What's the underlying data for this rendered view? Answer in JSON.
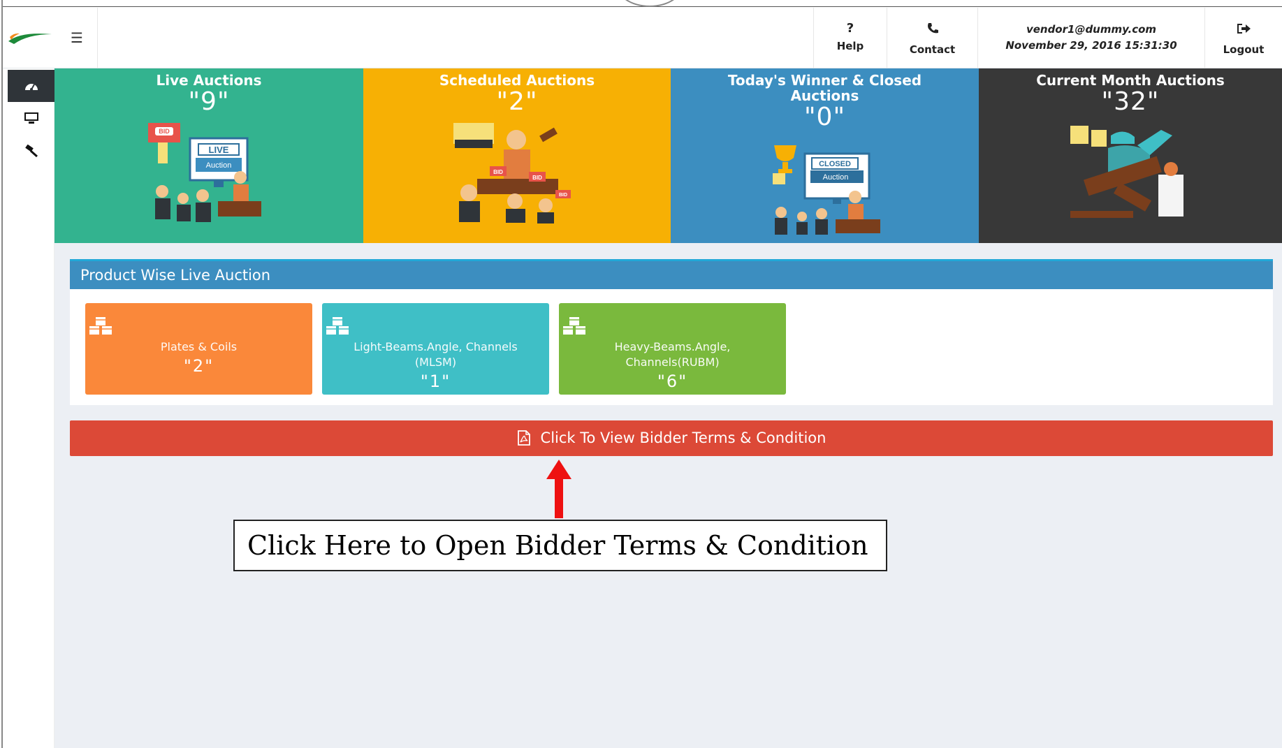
{
  "header": {
    "help_label": "Help",
    "help_icon": "question-icon",
    "contact_label": "Contact",
    "contact_icon": "phone-icon",
    "user_email": "vendor1@dummy.com",
    "datetime": "November 29, 2016 15:31:30",
    "logout_label": "Logout",
    "logout_icon": "sign-out-icon"
  },
  "sidebar": {
    "items": [
      {
        "icon": "dashboard-icon",
        "active": true
      },
      {
        "icon": "desktop-icon",
        "active": false
      },
      {
        "icon": "gavel-icon",
        "active": false
      }
    ]
  },
  "tiles": [
    {
      "title": "Live Auctions",
      "count": "\"9\"",
      "color": "#33b38f"
    },
    {
      "title": "Scheduled Auctions",
      "count": "\"2\"",
      "color": "#f7b004"
    },
    {
      "title": "Today's Winner & Closed Auctions",
      "count": "\"0\"",
      "color": "#3c8ec0"
    },
    {
      "title": "Current Month Auctions",
      "count": "\"32\"",
      "color": "#383838"
    }
  ],
  "art": {
    "live_sign": "LIVE",
    "live_sub": "Auction",
    "bid": "BID",
    "closed_sign": "CLOSED",
    "closed_sub": "Auction"
  },
  "products": {
    "title": "Product Wise Live Auction",
    "items": [
      {
        "name": "Plates & Coils",
        "count": "\"2\"",
        "color": "#fa883a"
      },
      {
        "name": "Light-Beams.Angle, Channels (MLSM)",
        "count": "\"1\"",
        "color": "#3fbfc6"
      },
      {
        "name": "Heavy-Beams.Angle, Channels(RUBM)",
        "count": "\"6\"",
        "color": "#7ab93d"
      }
    ]
  },
  "terms_button": {
    "label": "Click To View Bidder Terms & Condition",
    "icon": "file-pdf-icon",
    "color": "#dc4937"
  },
  "annotation": {
    "text": "Click Here to Open Bidder Terms & Condition",
    "arrow_color": "#ee1111"
  }
}
